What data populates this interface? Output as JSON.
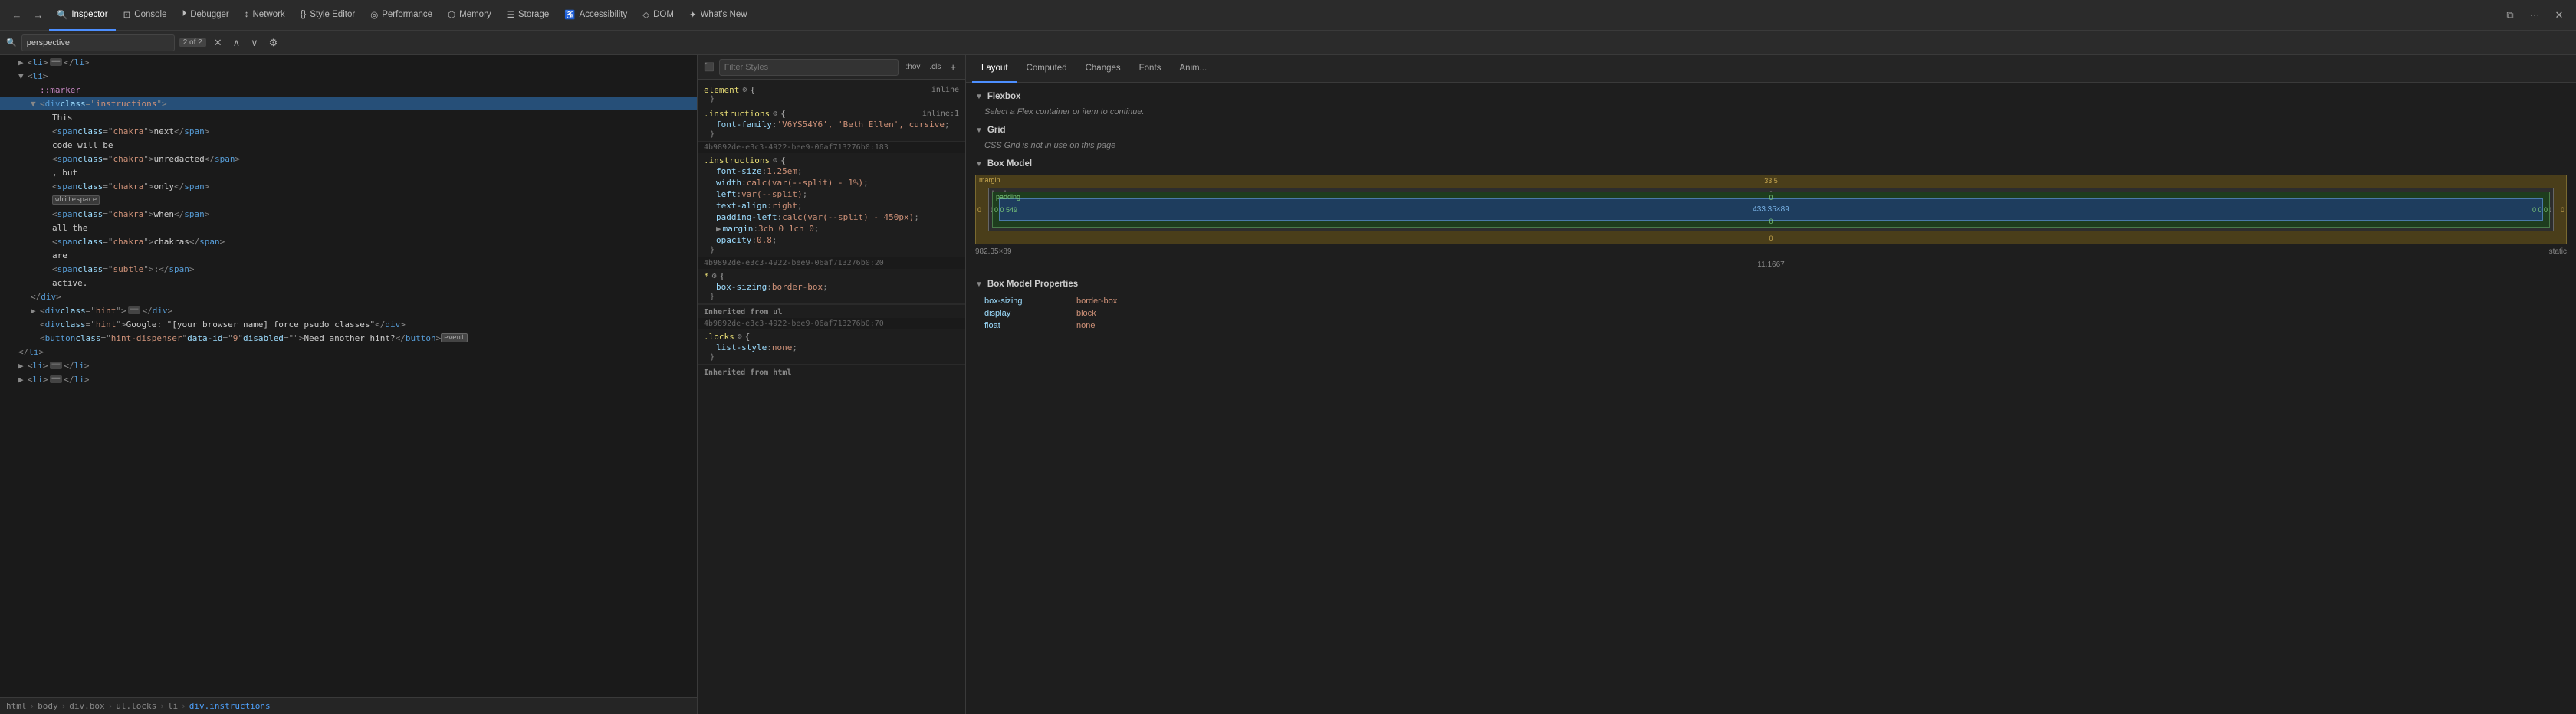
{
  "toolbar": {
    "tabs": [
      {
        "id": "inspector",
        "label": "Inspector",
        "icon": "🔍",
        "active": true
      },
      {
        "id": "console",
        "label": "Console",
        "icon": "⊡"
      },
      {
        "id": "debugger",
        "label": "Debugger",
        "icon": "⏵"
      },
      {
        "id": "network",
        "label": "Network",
        "icon": "↕"
      },
      {
        "id": "style-editor",
        "label": "Style Editor",
        "icon": "{}"
      },
      {
        "id": "performance",
        "label": "Performance",
        "icon": "◎"
      },
      {
        "id": "memory",
        "label": "Memory",
        "icon": "⬡"
      },
      {
        "id": "storage",
        "label": "Storage",
        "icon": "☰"
      },
      {
        "id": "accessibility",
        "label": "Accessibility",
        "icon": "♿"
      },
      {
        "id": "dom",
        "label": "DOM",
        "icon": "◇"
      },
      {
        "id": "whats-new",
        "label": "What's New",
        "icon": "✦"
      }
    ]
  },
  "search": {
    "placeholder": "perspective",
    "count": "2 of 2"
  },
  "html_tree": {
    "lines": [
      {
        "indent": 0,
        "content": "<li>═══</li>",
        "type": "collapsed"
      },
      {
        "indent": 0,
        "content": "<li>",
        "type": "open",
        "expanded": true
      },
      {
        "indent": 1,
        "content": "::marker",
        "type": "pseudo"
      },
      {
        "indent": 1,
        "content": "<div class=\"instructions\">",
        "type": "open",
        "selected": true,
        "expanded": true
      },
      {
        "indent": 2,
        "content": "This",
        "type": "text"
      },
      {
        "indent": 2,
        "content": "<span class=\"chakra\">next</span>",
        "type": "element"
      },
      {
        "indent": 2,
        "content": "code will be",
        "type": "text"
      },
      {
        "indent": 2,
        "content": "<span class=\"chakra\">unredacted</span>",
        "type": "element"
      },
      {
        "indent": 2,
        "content": ", but",
        "type": "text"
      },
      {
        "indent": 2,
        "content": "<span class=\"chakra\">only</span>",
        "type": "element"
      },
      {
        "indent": 2,
        "content": "whitespace",
        "type": "whitespace-badge"
      },
      {
        "indent": 2,
        "content": "<span class=\"chakra\">when</span>",
        "type": "element"
      },
      {
        "indent": 2,
        "content": "all the",
        "type": "text"
      },
      {
        "indent": 2,
        "content": "<span class=\"chakra\">chakras</span>",
        "type": "element"
      },
      {
        "indent": 2,
        "content": "are",
        "type": "text"
      },
      {
        "indent": 2,
        "content": "<span class=\"subtle\">:</span>",
        "type": "element"
      },
      {
        "indent": 2,
        "content": "active.",
        "type": "text"
      },
      {
        "indent": 1,
        "content": "</div>",
        "type": "close"
      },
      {
        "indent": 1,
        "content": "<div class=\"hint\">═══</div>",
        "type": "collapsed"
      },
      {
        "indent": 1,
        "content": "<div class=\"hint\">Google: \"[your browser name] force psudo classes\"</div>",
        "type": "element"
      },
      {
        "indent": 1,
        "content": "<button class=\"hint-dispenser\" data-id=\"9\" disabled=\"\">Need another hint?</button>",
        "type": "element",
        "has_event": true
      },
      {
        "indent": 0,
        "content": "</li>",
        "type": "close"
      },
      {
        "indent": 0,
        "content": "<li>═══</li>",
        "type": "collapsed"
      },
      {
        "indent": 0,
        "content": "<li>═══</li>",
        "type": "collapsed"
      }
    ]
  },
  "breadcrumb": {
    "items": [
      "html",
      "body",
      "div.box",
      "ul.locks",
      "li",
      "div.instructions"
    ]
  },
  "css_panel": {
    "filter_placeholder": "Filter Styles",
    "rules": [
      {
        "selector": "element",
        "icon": "⚙",
        "badge": "inline",
        "props": []
      },
      {
        "selector": ".instructions",
        "icon": "⚙",
        "badge": "inline:1",
        "props": [
          {
            "name": "font-family",
            "value": "'V6YS54Y6', 'Beth_Ellen', cursive"
          }
        ]
      },
      {
        "source": "4b9892de-e3c3-4922-bee9-06af713276b0:183",
        "selector": ".instructions",
        "icon": "⚙",
        "props": [
          {
            "name": "font-size",
            "value": "1.25em"
          },
          {
            "name": "width",
            "value": "calc(var(--split) - 1%)"
          },
          {
            "name": "left",
            "value": "var(--split)"
          },
          {
            "name": "text-align",
            "value": "right"
          },
          {
            "name": "padding-left",
            "value": "calc(var(--split) - 450px)"
          },
          {
            "name": "margin",
            "value": "3ch 0 1ch 0",
            "expanded": true
          },
          {
            "name": "opacity",
            "value": "0.8"
          }
        ]
      },
      {
        "source": "4b9892de-e3c3-4922-bee9-06af713276b0:20",
        "selector": "* ⚙ {",
        "props": [
          {
            "name": "box-sizing",
            "value": "border-box"
          }
        ]
      },
      {
        "inherited_from": "Inherited from ul",
        "selector": ".locks",
        "icon": "⚙",
        "source": "4b9892de-e3c3-4922-bee9-06af713276b0:70",
        "props": [
          {
            "name": "list-style",
            "value": "none"
          }
        ]
      },
      {
        "inherited_from": "Inherited from html"
      }
    ]
  },
  "layout_panel": {
    "tabs": [
      {
        "id": "layout",
        "label": "Layout",
        "active": true
      },
      {
        "id": "computed",
        "label": "Computed"
      },
      {
        "id": "changes",
        "label": "Changes"
      },
      {
        "id": "fonts",
        "label": "Fonts"
      },
      {
        "id": "animations",
        "label": "Anim..."
      }
    ],
    "sections": {
      "flexbox": {
        "title": "Flexbox",
        "hint": "Select a Flex container or item to continue."
      },
      "grid": {
        "title": "Grid",
        "hint": "CSS Grid is not in use on this page"
      },
      "box_model": {
        "title": "Box Model",
        "margin_top": "33.5",
        "margin_right": "0",
        "margin_bottom": "0",
        "margin_left": "0",
        "border_top": "0",
        "border_right": "0",
        "border_bottom": "0",
        "border_left": "0",
        "padding_top": "0",
        "padding_right": "0",
        "padding_bottom": "0",
        "padding_left": "549",
        "content_width": "433.35",
        "content_height": "89",
        "content_display": "433.35×89",
        "left_label": "0 0 549",
        "right_label": "0 0 0",
        "dims": "982.35×89"
      },
      "box_model_bottom": {
        "bottom_val": "11.1667",
        "static_label": "static"
      },
      "properties": {
        "title": "Box Model Properties",
        "props": [
          {
            "name": "box-sizing",
            "value": "border-box"
          },
          {
            "name": "display",
            "value": "block"
          },
          {
            "name": "float",
            "value": "none"
          }
        ]
      }
    }
  }
}
